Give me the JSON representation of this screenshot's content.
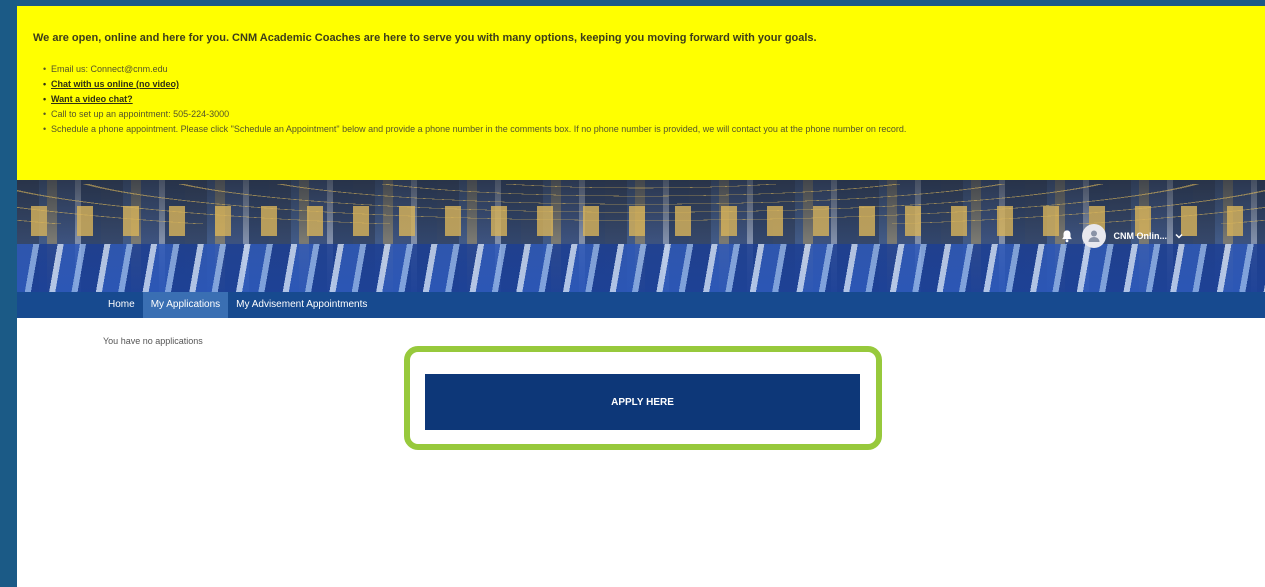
{
  "banner": {
    "message": "We are open, online and here for you. CNM Academic Coaches are here to serve you with many options, keeping you moving forward with your goals.",
    "items": [
      {
        "text": "Email us: Connect@cnm.edu",
        "link": false
      },
      {
        "text": "Chat with us online (no video)",
        "link": true
      },
      {
        "text": "Want a video chat?",
        "link": true
      },
      {
        "text": "Call to set up an appointment: 505-224-3000",
        "link": false
      },
      {
        "text": "Schedule a phone appointment. Please click \"Schedule an Appointment\" below and provide a phone number in the comments box.  If no phone number is provided, we will contact you at the phone number on record.",
        "link": false
      }
    ]
  },
  "header": {
    "user_name": "CNM Onlin..."
  },
  "nav": {
    "tabs": [
      {
        "label": "Home",
        "active": false
      },
      {
        "label": "My Applications",
        "active": true
      },
      {
        "label": "My Advisement Appointments",
        "active": false
      }
    ]
  },
  "main": {
    "empty_message": "You have no applications",
    "apply_label": "APPLY HERE"
  },
  "colors": {
    "banner": "#ffff00",
    "nav": "#174a8f",
    "apply_button": "#0d3778",
    "highlight": "#97c93c"
  }
}
